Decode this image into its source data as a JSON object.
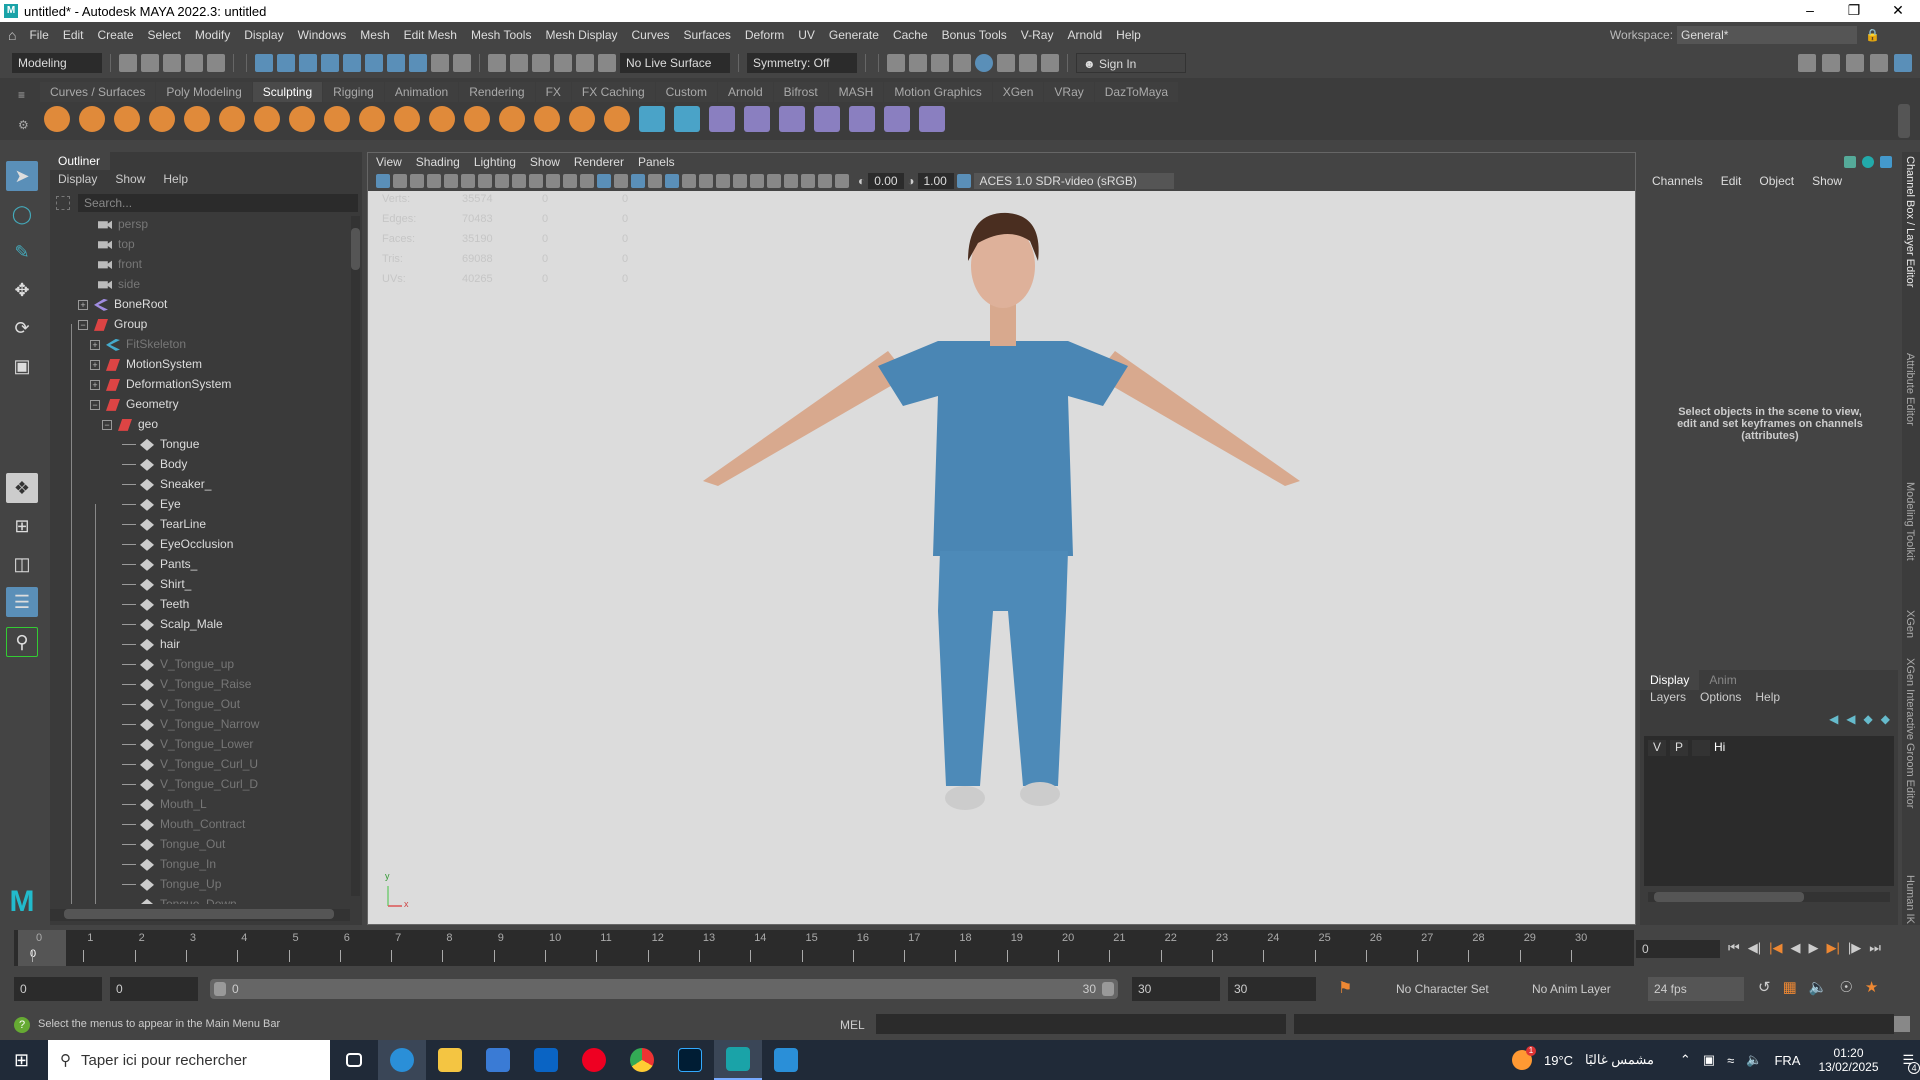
{
  "window": {
    "title": "untitled* - Autodesk MAYA 2022.3: untitled",
    "logo": "M"
  },
  "menubar": [
    "File",
    "Edit",
    "Create",
    "Select",
    "Modify",
    "Display",
    "Windows",
    "Mesh",
    "Edit Mesh",
    "Mesh Tools",
    "Mesh Display",
    "Curves",
    "Surfaces",
    "Deform",
    "UV",
    "Generate",
    "Cache",
    "Bonus Tools",
    "V-Ray",
    "Arnold",
    "Help"
  ],
  "workspace": {
    "label": "Workspace:",
    "value": "General*"
  },
  "statusline": {
    "menuset": "Modeling",
    "live_surface": "No Live Surface",
    "symmetry": "Symmetry: Off",
    "sign_in": "Sign In"
  },
  "shelf": {
    "tabs": [
      "Curves / Surfaces",
      "Poly Modeling",
      "Sculpting",
      "Rigging",
      "Animation",
      "Rendering",
      "FX",
      "FX Caching",
      "Custom",
      "Arnold",
      "Bifrost",
      "MASH",
      "Motion Graphics",
      "XGen",
      "VRay",
      "DazToMaya"
    ],
    "active": "Sculpting",
    "icons": [
      "sculpt-icon",
      "smooth-icon",
      "relax-icon",
      "grab-icon",
      "pinch-icon",
      "flatten-icon",
      "foamy-icon",
      "spray-icon",
      "repeat-icon",
      "imprint-icon",
      "wax-icon",
      "scrape-icon",
      "fill-icon",
      "knife-icon",
      "smear-icon",
      "bulge-icon",
      "amplify-icon",
      "freeze-icon",
      "freeze-all-icon",
      "sculpt-settings-icon",
      "mask-icon",
      "symmetry-icon",
      "blend-shape-icon",
      "shape-editor-icon",
      "pose-icon",
      "wrap-icon"
    ]
  },
  "outliner": {
    "title": "Outliner",
    "menus": [
      "Display",
      "Show",
      "Help"
    ],
    "search_placeholder": "Search...",
    "items": [
      {
        "label": "persp",
        "type": "camera",
        "depth": 0,
        "dim": true
      },
      {
        "label": "top",
        "type": "camera",
        "depth": 0,
        "dim": true
      },
      {
        "label": "front",
        "type": "camera",
        "depth": 0,
        "dim": true
      },
      {
        "label": "side",
        "type": "camera",
        "depth": 0,
        "dim": true
      },
      {
        "label": "BoneRoot",
        "type": "joint",
        "depth": 0,
        "exp": "+"
      },
      {
        "label": "Group",
        "type": "group",
        "depth": 0,
        "exp": "-"
      },
      {
        "label": "FitSkeleton",
        "type": "curve",
        "depth": 1,
        "exp": "+",
        "dim": true
      },
      {
        "label": "MotionSystem",
        "type": "group",
        "depth": 1,
        "exp": "+"
      },
      {
        "label": "DeformationSystem",
        "type": "group",
        "depth": 1,
        "exp": "+"
      },
      {
        "label": "Geometry",
        "type": "group",
        "depth": 1,
        "exp": "-"
      },
      {
        "label": "geo",
        "type": "group",
        "depth": 2,
        "exp": "-"
      },
      {
        "label": "Tongue",
        "type": "mesh",
        "depth": 3
      },
      {
        "label": "Body",
        "type": "mesh",
        "depth": 3
      },
      {
        "label": "Sneaker_",
        "type": "mesh",
        "depth": 3
      },
      {
        "label": "Eye",
        "type": "mesh",
        "depth": 3
      },
      {
        "label": "TearLine",
        "type": "mesh",
        "depth": 3
      },
      {
        "label": "EyeOcclusion",
        "type": "mesh",
        "depth": 3
      },
      {
        "label": "Pants_",
        "type": "mesh",
        "depth": 3
      },
      {
        "label": "Shirt_",
        "type": "mesh",
        "depth": 3
      },
      {
        "label": "Teeth",
        "type": "mesh",
        "depth": 3
      },
      {
        "label": "Scalp_Male",
        "type": "mesh",
        "depth": 3
      },
      {
        "label": "hair",
        "type": "mesh",
        "depth": 3
      },
      {
        "label": "V_Tongue_up",
        "type": "mesh",
        "depth": 3,
        "dim": true
      },
      {
        "label": "V_Tongue_Raise",
        "type": "mesh",
        "depth": 3,
        "dim": true
      },
      {
        "label": "V_Tongue_Out",
        "type": "mesh",
        "depth": 3,
        "dim": true
      },
      {
        "label": "V_Tongue_Narrow",
        "type": "mesh",
        "depth": 3,
        "dim": true
      },
      {
        "label": "V_Tongue_Lower",
        "type": "mesh",
        "depth": 3,
        "dim": true
      },
      {
        "label": "V_Tongue_Curl_U",
        "type": "mesh",
        "depth": 3,
        "dim": true
      },
      {
        "label": "V_Tongue_Curl_D",
        "type": "mesh",
        "depth": 3,
        "dim": true
      },
      {
        "label": "Mouth_L",
        "type": "mesh",
        "depth": 3,
        "dim": true
      },
      {
        "label": "Mouth_Contract",
        "type": "mesh",
        "depth": 3,
        "dim": true
      },
      {
        "label": "Tongue_Out",
        "type": "mesh",
        "depth": 3,
        "dim": true
      },
      {
        "label": "Tongue_In",
        "type": "mesh",
        "depth": 3,
        "dim": true
      },
      {
        "label": "Tongue_Up",
        "type": "mesh",
        "depth": 3,
        "dim": true
      },
      {
        "label": "Tongue_Down",
        "type": "mesh",
        "depth": 3,
        "dim": true
      }
    ]
  },
  "viewport": {
    "menus": [
      "View",
      "Shading",
      "Lighting",
      "Show",
      "Renderer",
      "Panels"
    ],
    "exposure": "0.00",
    "gamma": "1.00",
    "color_space": "ACES 1.0 SDR-video (sRGB)",
    "hud": [
      [
        "Verts:",
        "35574",
        "0",
        "0"
      ],
      [
        "Edges:",
        "70483",
        "0",
        "0"
      ],
      [
        "Faces:",
        "35190",
        "0",
        "0"
      ],
      [
        "Tris:",
        "69088",
        "0",
        "0"
      ],
      [
        "UVs:",
        "40265",
        "0",
        "0"
      ]
    ],
    "axis_x": "x",
    "axis_y": "y"
  },
  "channelbox": {
    "menus": [
      "Channels",
      "Edit",
      "Object",
      "Show"
    ],
    "hint": "Select objects in the scene to view, edit and set keyframes on channels (attributes)"
  },
  "layers": {
    "tabs": [
      "Display",
      "Anim"
    ],
    "menus": [
      "Layers",
      "Options",
      "Help"
    ],
    "v": "V",
    "p": "P",
    "name": "Hi"
  },
  "side_tabs": [
    "Channel Box / Layer Editor",
    "Attribute Editor",
    "Modeling Toolkit",
    "XGen",
    "XGen Interactive Groom Editor",
    "Human IK"
  ],
  "timeline": {
    "ticks": [
      "0",
      "1",
      "2",
      "3",
      "4",
      "5",
      "6",
      "7",
      "8",
      "9",
      "10",
      "11",
      "12",
      "13",
      "14",
      "15",
      "16",
      "17",
      "18",
      "19",
      "20",
      "21",
      "22",
      "23",
      "24",
      "25",
      "26",
      "27",
      "28",
      "29",
      "30"
    ],
    "current": "0",
    "current_field": "0"
  },
  "range": {
    "start": "0",
    "anim_start": "0",
    "slider_start": "0",
    "slider_end": "30",
    "end": "30",
    "anim_end": "30",
    "character_set": "No Character Set",
    "anim_layer": "No Anim Layer",
    "fps": "24 fps"
  },
  "cmdline": {
    "help": "Select the menus to appear in the Main Menu Bar",
    "lang": "MEL"
  },
  "taskbar": {
    "search": "Taper ici pour rechercher",
    "weather_temp": "19°C",
    "weather_text": "مشمس غالبًا",
    "lang": "FRA",
    "time": "01:20",
    "date": "13/02/2025",
    "notifications": "4",
    "weather_badge": "1"
  }
}
